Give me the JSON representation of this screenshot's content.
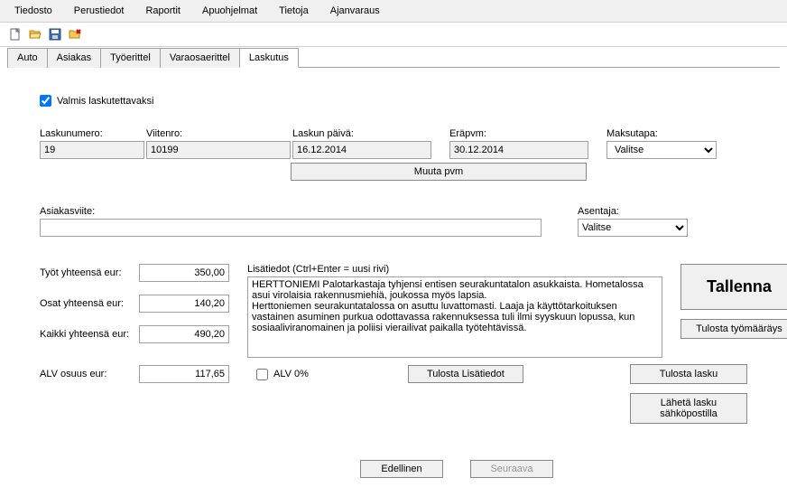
{
  "menu": {
    "tiedosto": "Tiedosto",
    "perustiedot": "Perustiedot",
    "raportit": "Raportit",
    "apuohjelmat": "Apuohjelmat",
    "tietoja": "Tietoja",
    "ajanvaraus": "Ajanvaraus"
  },
  "tabs": {
    "auto": "Auto",
    "asiakas": "Asiakas",
    "tyoerittel": "Työerittel",
    "varaosaerittel": "Varaosaerittel",
    "laskutus": "Laskutus"
  },
  "ready_checkbox": "Valmis laskutettavaksi",
  "ready_checked": true,
  "fields": {
    "invoice_no_label": "Laskunumero:",
    "invoice_no": "19",
    "ref_no_label": "Viitenro:",
    "ref_no": "10199",
    "invoice_date_label": "Laskun päivä:",
    "invoice_date": "16.12.2014",
    "due_date_label": "Eräpvm:",
    "due_date": "30.12.2014",
    "payment_method_label": "Maksutapa:",
    "payment_method": "Valitse"
  },
  "buttons": {
    "muuta_pvm": "Muuta pvm",
    "tallenna": "Tallenna",
    "tulosta_tyomaarays": "Tulosta työmääräys",
    "tulosta_lasku": "Tulosta lasku",
    "laheta_sahkoposti": "Lähetä lasku sähköpostilla",
    "tulosta_lisatiedot": "Tulosta Lisätiedot",
    "edellinen": "Edellinen",
    "seuraava": "Seuraava"
  },
  "customer_ref_label": "Asiakasviite:",
  "customer_ref": "",
  "installer_label": "Asentaja:",
  "installer": "Valitse",
  "totals": {
    "work_label": "Työt yhteensä eur:",
    "work": "350,00",
    "parts_label": "Osat yhteensä eur:",
    "parts": "140,20",
    "all_label": "Kaikki yhteensä eur:",
    "all": "490,20",
    "vat_label": "ALV osuus eur:",
    "vat": "117,65"
  },
  "lisatiedot_label": "Lisätiedot (Ctrl+Enter = uusi rivi)",
  "lisatiedot_text": "HERTTONIEMI Palotarkastaja tyhjensi entisen seurakuntatalon asukkaista. Hometalossa asui virolaisia rakennusmiehiä, joukossa myös lapsia.\nHerttoniemen seurakuntatalossa on asuttu luvattomasti. Laaja ja käyttötarkoituksen vastainen asuminen purkua odottavassa rakennuksessa tuli ilmi syyskuun lopussa, kun sosiaaliviranomainen ja poliisi vierailivat paikalla työtehtävissä.",
  "alv0_label": "ALV 0%",
  "alv0_checked": false
}
